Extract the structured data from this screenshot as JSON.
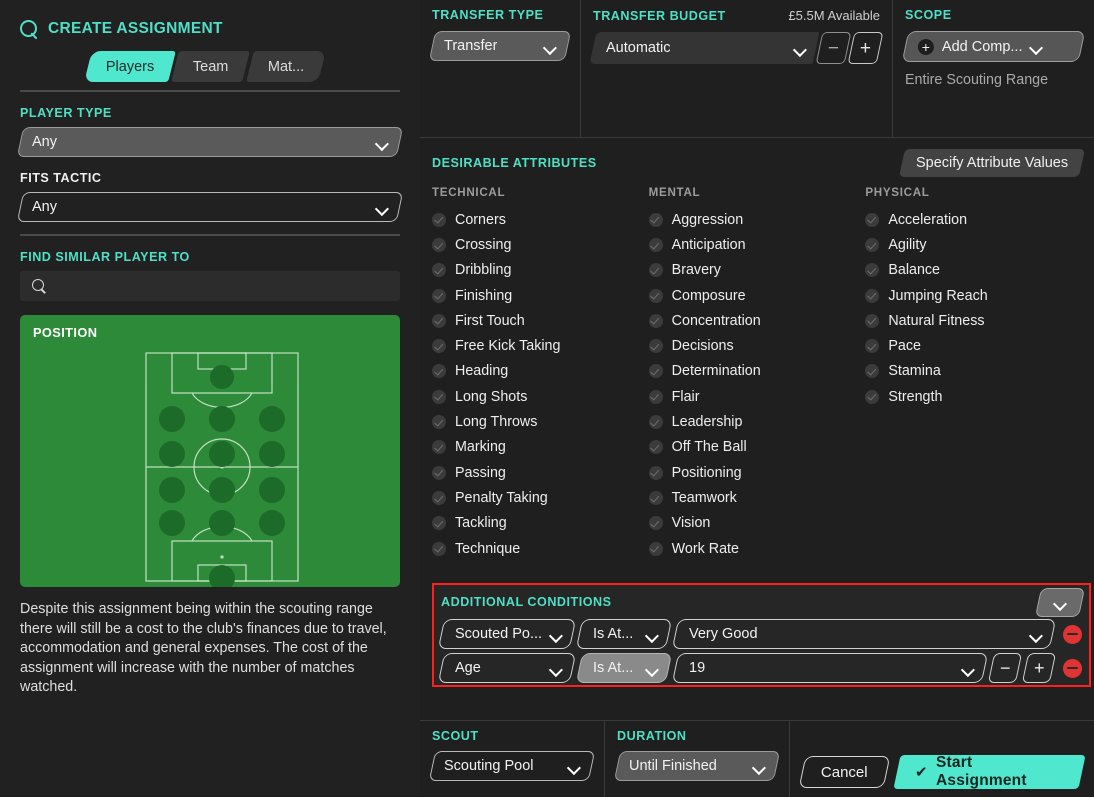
{
  "header": {
    "icon": "search-icon",
    "title": "CREATE ASSIGNMENT",
    "tabs": [
      {
        "label": "Players",
        "active": true
      },
      {
        "label": "Team",
        "active": false
      },
      {
        "label": "Mat...",
        "active": false
      }
    ]
  },
  "left": {
    "player_type": {
      "label": "PLAYER TYPE",
      "value": "Any"
    },
    "fits_tactic": {
      "label": "FITS TACTIC",
      "value": "Any"
    },
    "find_similar": {
      "label": "FIND SIMILAR PLAYER TO",
      "value": "",
      "placeholder": ""
    },
    "position": {
      "label": "POSITION"
    },
    "note": "Despite this assignment being within the scouting range there will still be a cost to the club's finances due to travel, accommodation and general expenses. The cost of the assignment will increase with the number of matches watched."
  },
  "top": {
    "transfer_type": {
      "label": "TRANSFER TYPE",
      "value": "Transfer"
    },
    "transfer_budget": {
      "label": "TRANSFER BUDGET",
      "available": "£5.5M Available",
      "value": "Automatic",
      "minus": "−",
      "plus": "+"
    },
    "scope": {
      "label": "SCOPE",
      "add_label": "Add Comp...",
      "plus": "+",
      "subtitle": "Entire Scouting Range"
    }
  },
  "attributes": {
    "label": "DESIRABLE ATTRIBUTES",
    "specify_button": "Specify Attribute Values",
    "columns": [
      {
        "heading": "TECHNICAL",
        "items": [
          "Corners",
          "Crossing",
          "Dribbling",
          "Finishing",
          "First Touch",
          "Free Kick Taking",
          "Heading",
          "Long Shots",
          "Long Throws",
          "Marking",
          "Passing",
          "Penalty Taking",
          "Tackling",
          "Technique"
        ]
      },
      {
        "heading": "MENTAL",
        "items": [
          "Aggression",
          "Anticipation",
          "Bravery",
          "Composure",
          "Concentration",
          "Decisions",
          "Determination",
          "Flair",
          "Leadership",
          "Off The Ball",
          "Positioning",
          "Teamwork",
          "Vision",
          "Work Rate"
        ]
      },
      {
        "heading": "PHYSICAL",
        "items": [
          "Acceleration",
          "Agility",
          "Balance",
          "Jumping Reach",
          "Natural Fitness",
          "Pace",
          "Stamina",
          "Strength"
        ]
      }
    ]
  },
  "conditions": {
    "label": "ADDITIONAL CONDITIONS",
    "highlight_color": "#ff1f1f",
    "rows": [
      {
        "field": "Scouted Po...",
        "operator": "Is At...",
        "value": "Very Good",
        "has_stepper": false,
        "remove": "remove-icon"
      },
      {
        "field": "Age",
        "operator": "Is At...",
        "value": "19",
        "has_stepper": true,
        "minus": "−",
        "plus": "+",
        "remove": "remove-icon"
      }
    ]
  },
  "bottom": {
    "scout": {
      "label": "SCOUT",
      "value": "Scouting Pool"
    },
    "duration": {
      "label": "DURATION",
      "value": "Until Finished"
    },
    "cancel": "Cancel",
    "start": {
      "tick": "✔",
      "label": "Start Assignment"
    }
  },
  "colors": {
    "accent_teal": "#4fdfc7",
    "button_teal": "#4fe7cd",
    "pitch_green": "#2d8a38",
    "pitch_dot": "#1d6b28",
    "danger_red": "#ff1f1f"
  }
}
